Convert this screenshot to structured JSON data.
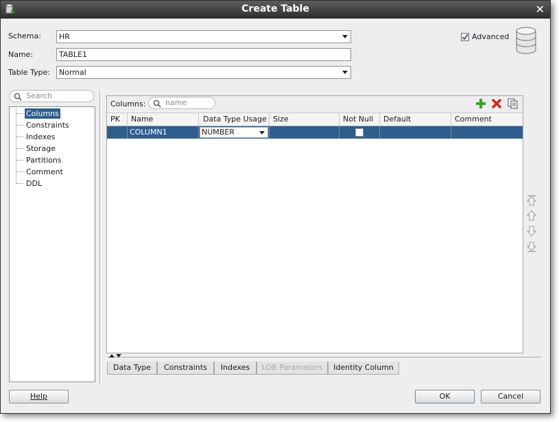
{
  "window": {
    "title": "Create Table"
  },
  "form": {
    "schema_label": "Schema:",
    "schema_value": "HR",
    "name_label": "Name:",
    "name_value": "TABLE1",
    "table_type_label": "Table Type:",
    "table_type_value": "Normal",
    "advanced_label": "Advanced",
    "advanced_checked": true
  },
  "nav": {
    "search_placeholder": "Search",
    "items": [
      "Columns",
      "Constraints",
      "Indexes",
      "Storage",
      "Partitions",
      "Comment",
      "DDL"
    ],
    "selected": "Columns"
  },
  "columns_panel": {
    "label": "Columns:",
    "filter_placeholder": "name",
    "headers": [
      "PK",
      "Name",
      "Data Type Usage",
      "Size",
      "Not Null",
      "Default",
      "Comment"
    ],
    "rows": [
      {
        "pk": "",
        "name": "COLUMN1",
        "data_type": "NUMBER",
        "size": "",
        "not_null": false,
        "default": "",
        "comment": ""
      }
    ]
  },
  "bottom_tabs": [
    {
      "label": "Data Type",
      "enabled": true
    },
    {
      "label": "Constraints",
      "enabled": true
    },
    {
      "label": "Indexes",
      "enabled": true
    },
    {
      "label": "LOB Parameters",
      "enabled": false
    },
    {
      "label": "Identity Column",
      "enabled": true
    }
  ],
  "buttons": {
    "help": "Help",
    "ok": "OK",
    "cancel": "Cancel"
  },
  "colors": {
    "selection": "#2f5e8e",
    "add_green": "#3aa12b",
    "delete_red": "#d62020"
  }
}
